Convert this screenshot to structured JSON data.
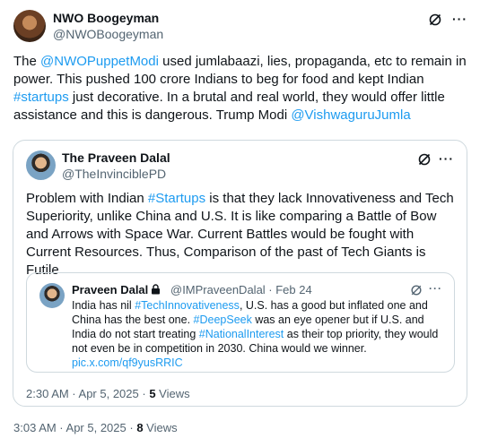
{
  "main_post": {
    "author_name": "NWO Boogeyman",
    "author_handle": "@NWOBoogeyman",
    "text_parts": [
      {
        "t": "The ",
        "link": false
      },
      {
        "t": "@NWOPuppetModi",
        "link": true
      },
      {
        "t": " used jumlabaazi, lies, propaganda, etc to remain in power. This pushed 100 crore Indians to beg for food and kept Indian ",
        "link": false
      },
      {
        "t": "#startups",
        "link": true
      },
      {
        "t": " just decorative. In a brutal and real world, they would offer little assistance and this is dangerous. Trump Modi ",
        "link": false
      },
      {
        "t": "@VishwaguruJumla",
        "link": true
      }
    ],
    "timestamp": "3:03 AM · Apr 5, 2025 · ",
    "views_count": "8",
    "views_label": " Views"
  },
  "quoted_post": {
    "author_name": "The Praveen Dalal",
    "author_handle": "@TheInvinciblePD",
    "text_parts": [
      {
        "t": "Problem with Indian ",
        "link": false
      },
      {
        "t": "#Startups",
        "link": true
      },
      {
        "t": " is that they lack Innovativeness and Tech Superiority, unlike China and U.S. It is like comparing a Battle of Bow and Arrows with Space War. Current Battles would be fought with Current Resources. Thus, Comparison of the past of Tech Giants is Futile",
        "link": false
      }
    ],
    "timestamp": "2:30 AM · Apr 5, 2025 · ",
    "views_count": "5",
    "views_label": " Views"
  },
  "nested_quote": {
    "author_name": "Praveen Dalal",
    "author_handle_date": "@IMPraveenDalal · Feb 24",
    "text_parts": [
      {
        "t": "India has nil ",
        "link": false
      },
      {
        "t": "#TechInnovativeness",
        "link": true
      },
      {
        "t": ", U.S. has a good but inflated one and China has the best one. ",
        "link": false
      },
      {
        "t": "#DeepSeek",
        "link": true
      },
      {
        "t": "  was an eye opener but if U.S. and India do not start treating ",
        "link": false
      },
      {
        "t": "#NationalInterest",
        "link": true
      },
      {
        "t": " as their top priority, they would not even be in competition in 2030. China would we winner. ",
        "link": false
      },
      {
        "t": "pic.x.com/qf9yusRRIC",
        "link": true
      }
    ]
  },
  "icons": {
    "grok": "grok-icon",
    "more": "more-icon",
    "lock": "lock-icon",
    "more_glyph": "···"
  },
  "colors": {
    "link": "#1d9bf0",
    "border": "#cfd9de",
    "secondary_text": "#536471"
  }
}
